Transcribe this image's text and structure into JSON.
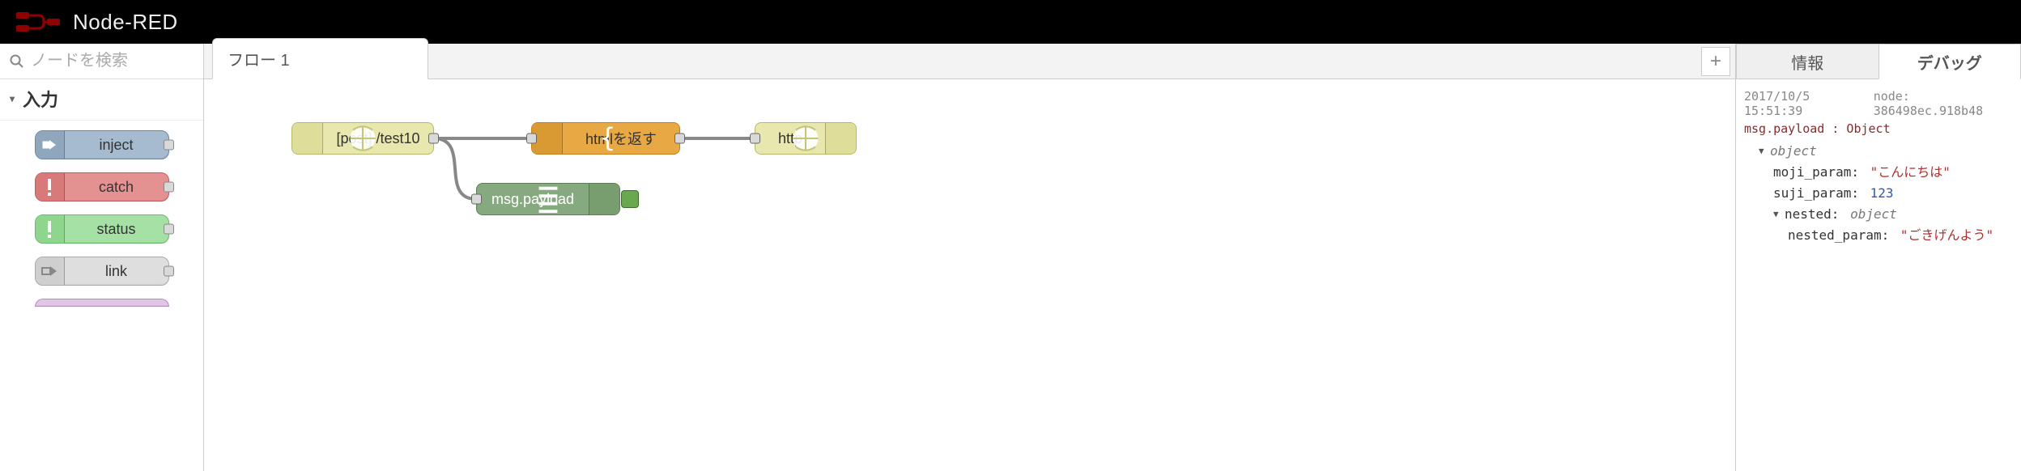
{
  "header": {
    "title": "Node-RED"
  },
  "palette": {
    "search_placeholder": "ノードを検索",
    "category": "入力",
    "nodes": {
      "inject": "inject",
      "catch": "catch",
      "status": "status",
      "link": "link"
    }
  },
  "workspace": {
    "tab_label": "フロー 1",
    "nodes": {
      "http_in": "[post] /test10",
      "template": "htmlを返す",
      "http_out": "http",
      "debug": "msg.payload"
    }
  },
  "sidebar": {
    "tabs": {
      "info": "情報",
      "debug": "デバッグ"
    },
    "debug": {
      "timestamp": "2017/10/5 15:51:39",
      "node_prefix": "node:",
      "node_id": "386498ec.918b48",
      "path": "msg.payload : Object",
      "root_kw": "object",
      "fields": {
        "moji_param_key": "moji_param:",
        "moji_param_val": "\"こんにちは\"",
        "suji_param_key": "suji_param:",
        "suji_param_val": "123",
        "nested_key": "nested:",
        "nested_kw": "object",
        "nested_param_key": "nested_param:",
        "nested_param_val": "\"ごきげんよう\""
      }
    }
  }
}
